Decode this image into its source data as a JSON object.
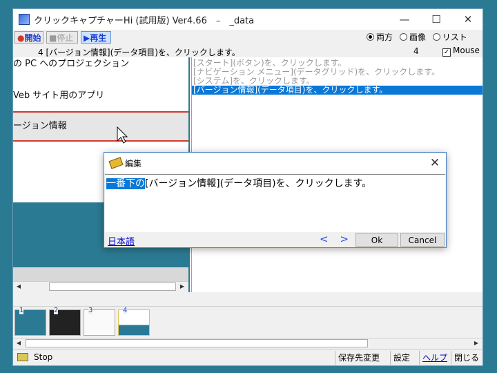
{
  "window": {
    "title": "クリックキャプチャーHi (試用版) Ver4.66　–　_data",
    "minimize": "—",
    "maximize": "☐",
    "close": "✕"
  },
  "toolbar": {
    "start_label": "開始",
    "stop_label": "停止",
    "play_label": "再生",
    "view_options": [
      {
        "label": "両方",
        "selected": true
      },
      {
        "label": "画像",
        "selected": false
      },
      {
        "label": "リスト",
        "selected": false
      }
    ]
  },
  "status_line": {
    "text": "4 [バージョン情報](データ項目)を、クリックします。",
    "count": "4",
    "mouse_checked": true,
    "mouse_label": "Mouse"
  },
  "left_list": {
    "items": [
      {
        "label": "の PC へのプロジェクション",
        "selected": false
      },
      {
        "label": "Veb サイト用のアプリ",
        "selected": false
      },
      {
        "label": "ージョン情報",
        "selected": true
      }
    ]
  },
  "right_list": {
    "items": [
      {
        "text": "[スタート](ボタン)を、クリックします。",
        "selected": false
      },
      {
        "text": "[ナビゲーション メニュー](データグリッド)を、クリックします。",
        "selected": false
      },
      {
        "text": "[システム]を、クリックします。",
        "selected": false
      },
      {
        "text": "[バージョン情報](データ項目)を、クリックします。",
        "selected": true
      }
    ]
  },
  "thumbnails": [
    {
      "num": "1"
    },
    {
      "num": "2"
    },
    {
      "num": "3"
    },
    {
      "num": "4"
    }
  ],
  "statusbar": {
    "state": "Stop",
    "save_dest": "保存先変更",
    "settings": "設定",
    "help": "ヘルプ",
    "close": "閉じる"
  },
  "dialog": {
    "title": "編集",
    "close": "✕",
    "text_selected": "一番下の",
    "text_rest": "[バージョン情報](データ項目)を、クリックします。",
    "language": "日本語",
    "nav": "< >",
    "ok": "Ok",
    "cancel": "Cancel"
  },
  "colors": {
    "desktop": "#2b7a93",
    "selection": "#0a78d7",
    "highlight_line": "#d0392b"
  }
}
